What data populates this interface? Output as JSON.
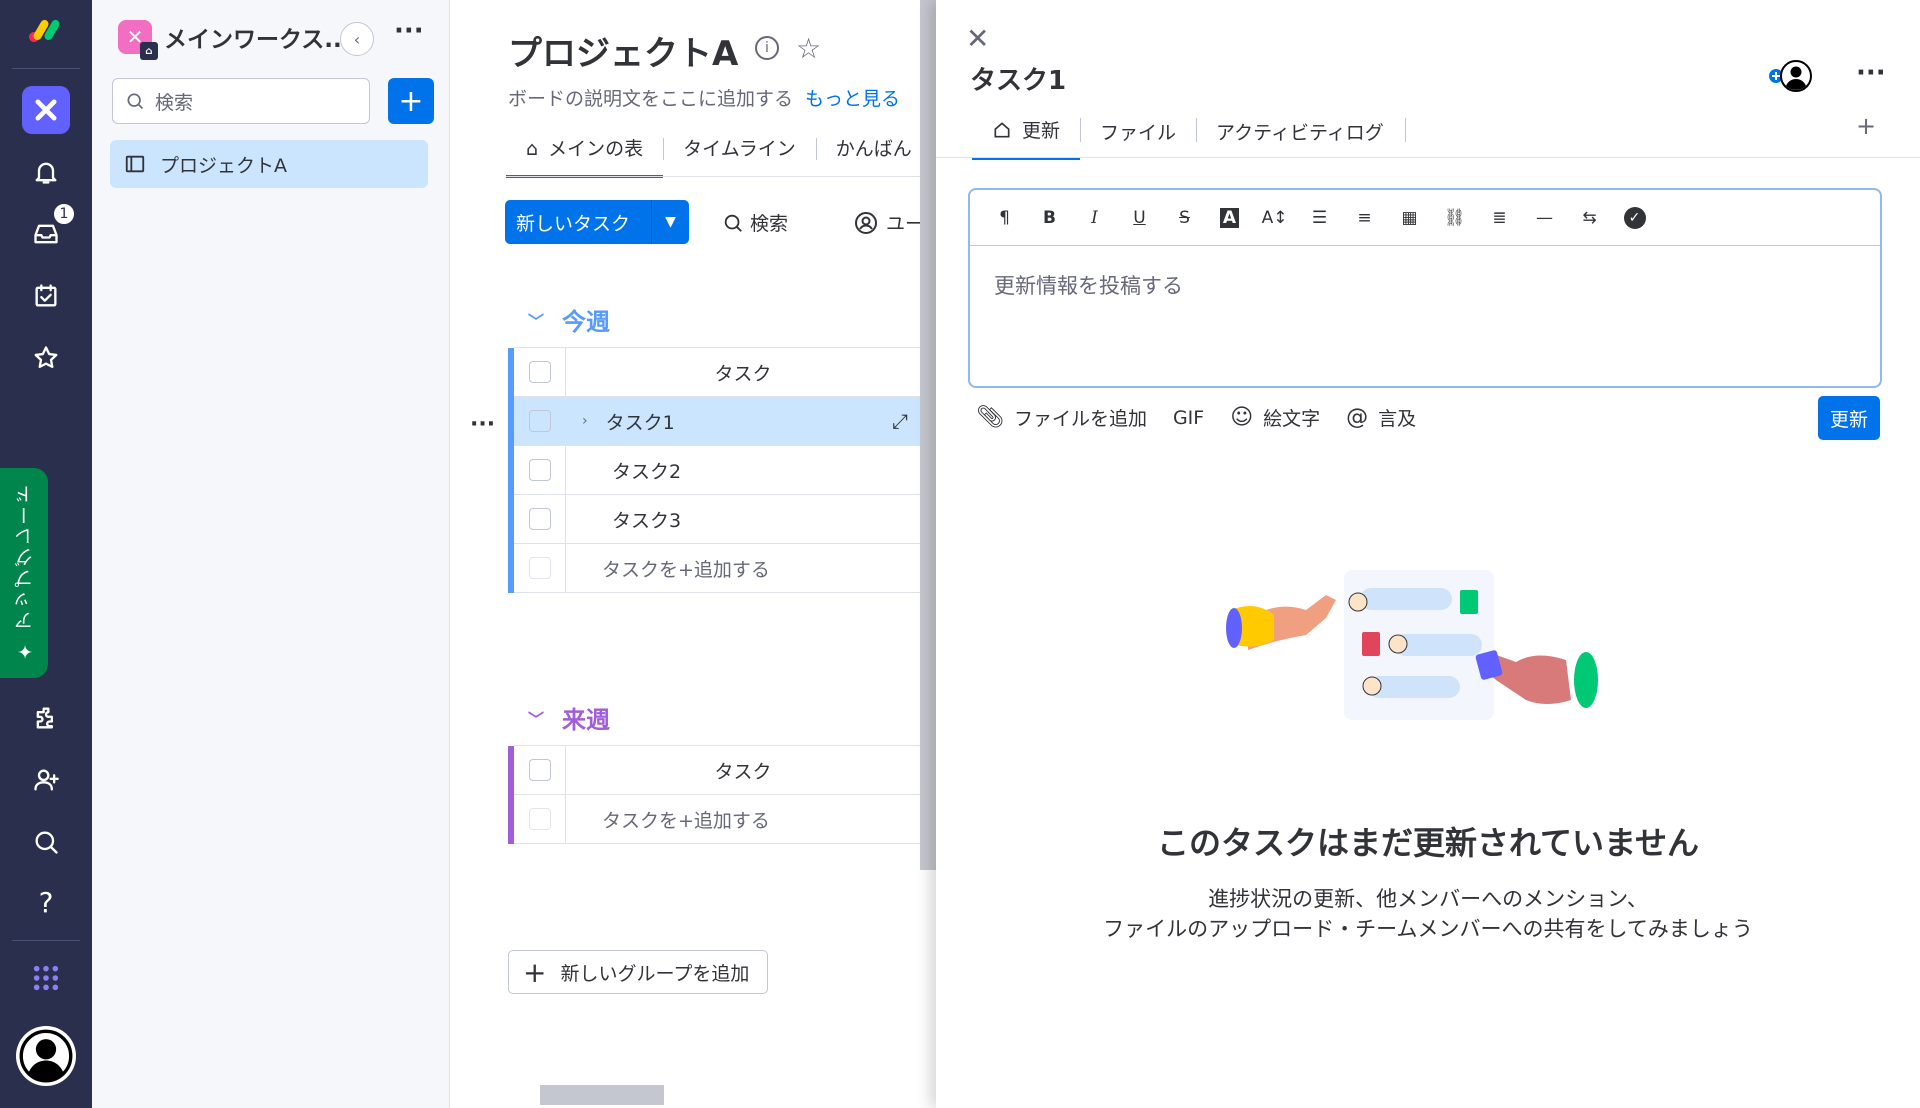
{
  "rail": {
    "notifications_badge": "1",
    "upgrade_label": "✦ アップグレード"
  },
  "workspace": {
    "name": "メインワークス...",
    "search_placeholder": "検索",
    "item": "プロジェクトA"
  },
  "board": {
    "title": "プロジェクトA",
    "description": "ボードの説明文をここに追加する",
    "more_link": "もっと見る",
    "tabs": [
      "メインの表",
      "タイムライン",
      "かんばん"
    ],
    "new_task_label": "新しいタスク",
    "search_label": "検索",
    "person_label": "ユー",
    "groups": [
      {
        "name": "今週",
        "color": "#579bfc",
        "column_header": "タスク",
        "rows": [
          "タスク1",
          "タスク2",
          "タスク3"
        ],
        "add_label": "タスクを+追加する"
      },
      {
        "name": "来週",
        "color": "#a25ddc",
        "column_header": "タスク",
        "rows": [],
        "add_label": "タスクを+追加する"
      }
    ],
    "add_group_label": "新しいグループを追加"
  },
  "panel": {
    "title": "タスク1",
    "tabs": [
      "更新",
      "ファイル",
      "アクティビティログ"
    ],
    "editor_placeholder": "更新情報を投稿する",
    "actions": {
      "add_file": "ファイルを追加",
      "gif": "GIF",
      "emoji": "絵文字",
      "mention": "言及"
    },
    "update_button": "更新",
    "empty_title": "このタスクはまだ更新されていません",
    "empty_sub_1": "進捗状況の更新、他メンバーへのメンション、",
    "empty_sub_2": "ファイルのアップロード・チームメンバーへの共有をしてみましょう"
  },
  "colors": {
    "rail_bg": "#292f4c",
    "primary": "#0073ea",
    "selected_row": "#cce5ff",
    "group_this_week": "#579bfc",
    "group_next_week": "#a25ddc",
    "upgrade_green": "#00854d"
  }
}
